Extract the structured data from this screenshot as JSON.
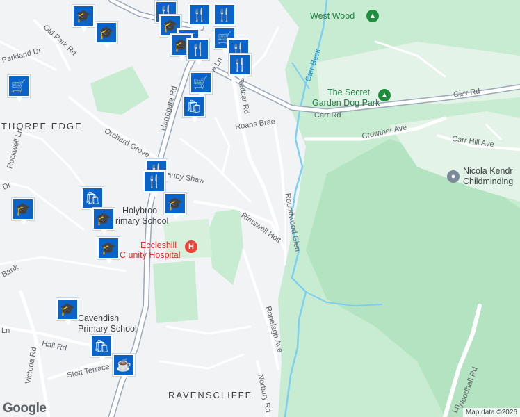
{
  "map": {
    "area_labels": [
      {
        "text": "THORPE EDGE"
      },
      {
        "text": "RAVENSCLIFFE"
      }
    ],
    "road_labels": [
      "Old Park Rd",
      "Parkland Dr",
      "Harrogate Rd",
      "Redcar Rd",
      "Roans Brae",
      "Orchard Grove",
      "Rockwell Ln",
      "Rimswell Holt",
      "Roundwood Glen",
      "Ranelagh Ave",
      "Crowther Ave",
      "Carr Rd",
      "Carr Rd",
      "Carr Hill Ave",
      "Hall Rd",
      "Victoria Rd",
      "Stott Terrace",
      "Norbury Rd",
      "Woodhall Rd",
      "Bank",
      "Dr",
      "Ln",
      "Ln",
      "anby Shaw",
      "w Ln"
    ],
    "waterway_label": "Carr Beck",
    "places": {
      "west_wood": "West Wood",
      "secret_garden_1": "The Secret",
      "secret_garden_2": "Garden Dog Park",
      "childminding_1": "Nicola Kendr",
      "childminding_2": "Childminding",
      "holybrook_1": "Holybroo",
      "holybrook_2": "rimary School",
      "hospital_1": "Eccleshill",
      "hospital_2": "C     unity Hospital",
      "cavendish_1": "Cavendish",
      "cavendish_2": "Primary School"
    },
    "markers": [
      {
        "type": "school",
        "icon": "🎓"
      },
      {
        "type": "school",
        "icon": "🎓"
      },
      {
        "type": "shopping",
        "icon": "🛒"
      },
      {
        "type": "restaurant",
        "icon": "🍴"
      },
      {
        "type": "shopping",
        "icon": "🛍"
      },
      {
        "type": "restaurant",
        "icon": "🍴"
      },
      {
        "type": "school",
        "icon": "🎓"
      },
      {
        "type": "school",
        "icon": "🎓"
      },
      {
        "type": "cafe",
        "icon": "☕"
      }
    ],
    "colors": {
      "land": "#f1f3f4",
      "park": "#c8ecd1",
      "water": "#7ccff0",
      "marker": "#0a63c9",
      "hospital": "#ea4335"
    },
    "logo": "Google",
    "attribution": "Map data ©2026"
  }
}
